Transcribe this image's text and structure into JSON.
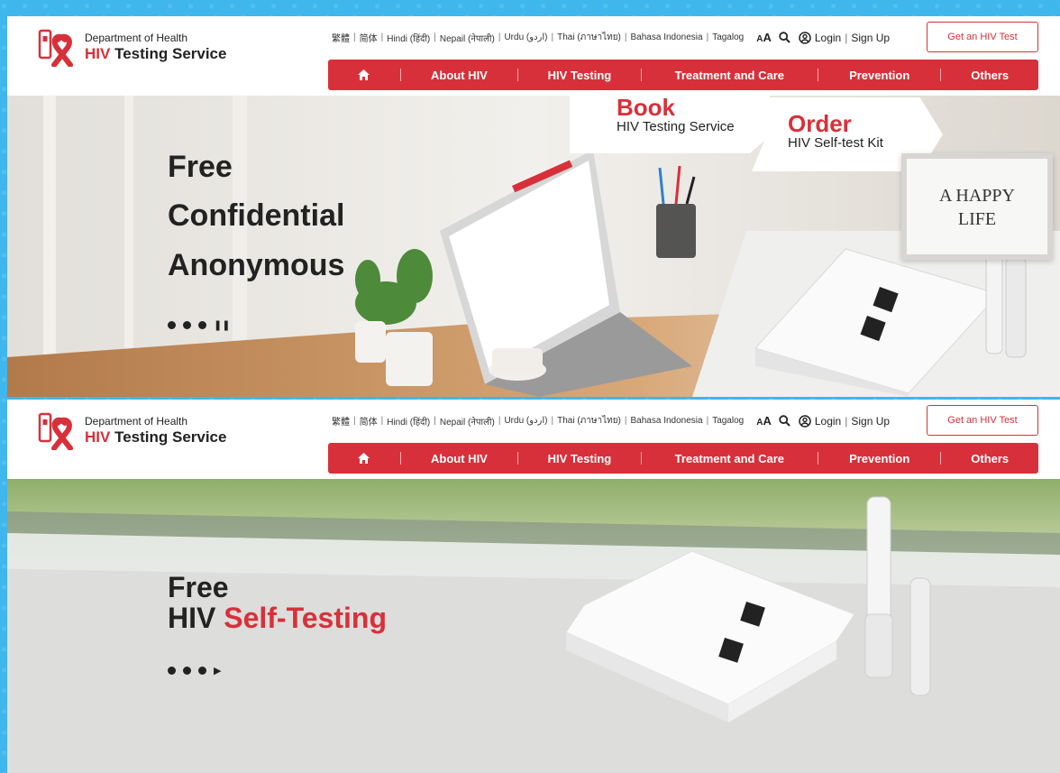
{
  "header": {
    "dept": "Department of Health",
    "service_hiv": "HIV",
    "service_rest": " Testing Service"
  },
  "topbar": {
    "languages": [
      "繁體",
      "简体",
      "Hindi (हिंदी)",
      "Nepail (नेपाली)",
      "Urdu (اردو)",
      "Thai (ภาษาไทย)",
      "Bahasa Indonesia",
      "Tagalog"
    ],
    "font_size_label_small": "A",
    "font_size_label_large": "A",
    "login": "Login",
    "signup": "Sign Up"
  },
  "cta": {
    "label": "Get an HIV Test"
  },
  "nav": {
    "items": [
      "About HIV",
      "HIV Testing",
      "Treatment and Care",
      "Prevention",
      "Others"
    ]
  },
  "slide1": {
    "lines": [
      "Free",
      "Confidential",
      "Anonymous"
    ],
    "book_big": "Book",
    "book_small": "HIV Testing Service",
    "order_big": "Order",
    "order_small": "HIV Self-test Kit",
    "frame_line1": "A HAPPY",
    "frame_line2": "LIFE"
  },
  "slide2": {
    "line1": "Free",
    "line2_plain": "HIV ",
    "line2_accent": "Self-Testing"
  },
  "colors": {
    "brand_red": "#d8303a",
    "page_bg": "#3fb6ec"
  }
}
